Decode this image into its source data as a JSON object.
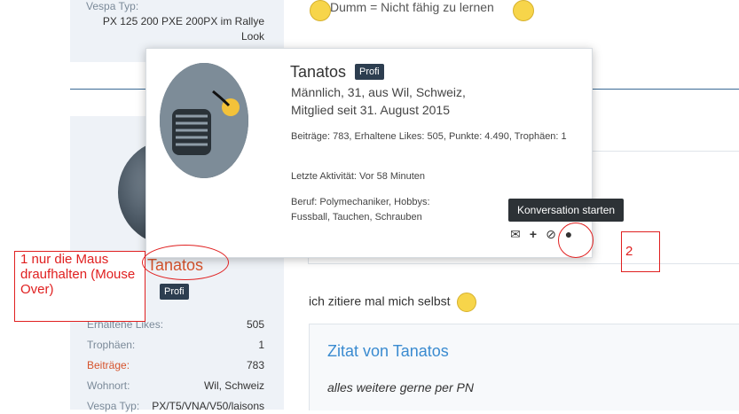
{
  "top_sidebar": {
    "label": "Vespa Typ:",
    "value": "PX 125 200 PXE 200PX im Rallye Look"
  },
  "top_post": {
    "emoji_text": "Dumm = Nicht fähig zu lernen"
  },
  "author_sidebar": {
    "name": "Tanatos",
    "badge": "Profi",
    "stats": [
      {
        "label": "Erhaltene Likes:",
        "value": "505"
      },
      {
        "label": "Trophäen:",
        "value": "1"
      },
      {
        "label": "Beiträge:",
        "value": "783"
      },
      {
        "label": "Wohnort:",
        "value": "Wil, Schweiz"
      },
      {
        "label": "Vespa Typ:",
        "value": "PX/T5/VNA/V50/laisons"
      }
    ]
  },
  "post": {
    "text": "ich zitiere mal mich selbst",
    "quote_title": "Zitat von Tanatos",
    "quote_text": "alles weitere gerne per PN"
  },
  "popover": {
    "name": "Tanatos",
    "badge": "Profi",
    "line1": "Männlich, 31, aus Wil, Schweiz,",
    "line2": "Mitglied seit 31. August 2015",
    "stats": "Beiträge: 783, Erhaltene Likes: 505, Punkte: 4.490, Trophäen: 1",
    "activity": "Letzte Aktivität: Vor 58 Minuten",
    "occupation": "Beruf: Polymechaniker, Hobbys: Fussball, Tauchen, Schrauben",
    "icons": [
      "envelope-icon",
      "plus-icon",
      "ban-icon",
      "more-icon"
    ]
  },
  "tooltip": "Konversation starten",
  "annotations": {
    "note1": "1 nur die Maus draufhalten (Mouse Over)",
    "note2": "2",
    "color": "#e02020"
  },
  "colors": {
    "accent_link": "#3a8bd0",
    "author_name": "#d6532c",
    "badge_bg": "#2d3e50"
  }
}
